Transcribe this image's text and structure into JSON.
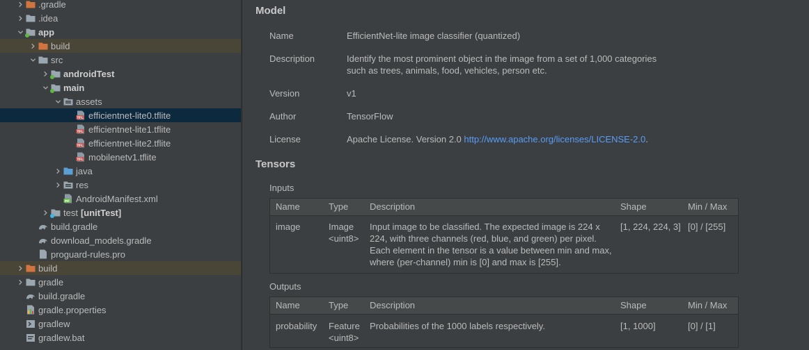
{
  "tree": [
    {
      "label": ".gradle",
      "depth": 1,
      "arrow": "right",
      "icon": "folder-orange-icon"
    },
    {
      "label": ".idea",
      "depth": 1,
      "arrow": "right",
      "icon": "folder-icon"
    },
    {
      "label": "app",
      "depth": 1,
      "arrow": "down",
      "icon": "module-folder-icon",
      "bold": true
    },
    {
      "label": "build",
      "depth": 2,
      "arrow": "right",
      "icon": "folder-orange-icon",
      "bg": "excluded"
    },
    {
      "label": "src",
      "depth": 2,
      "arrow": "down",
      "icon": "folder-icon"
    },
    {
      "label": "androidTest",
      "depth": 3,
      "arrow": "right",
      "icon": "test-folder-icon",
      "bold": true
    },
    {
      "label": "main",
      "depth": 3,
      "arrow": "down",
      "icon": "source-folder-icon",
      "bold": true
    },
    {
      "label": "assets",
      "depth": 4,
      "arrow": "down",
      "icon": "resource-folder-icon"
    },
    {
      "label": "efficientnet-lite0.tflite",
      "depth": 5,
      "arrow": "none",
      "icon": "tflite-file-icon",
      "bg": "selected"
    },
    {
      "label": "efficientnet-lite1.tflite",
      "depth": 5,
      "arrow": "none",
      "icon": "tflite-file-icon"
    },
    {
      "label": "efficientnet-lite2.tflite",
      "depth": 5,
      "arrow": "none",
      "icon": "tflite-file-icon"
    },
    {
      "label": "mobilenetv1.tflite",
      "depth": 5,
      "arrow": "none",
      "icon": "tflite-file-icon"
    },
    {
      "label": "java",
      "depth": 4,
      "arrow": "right",
      "icon": "java-folder-icon"
    },
    {
      "label": "res",
      "depth": 4,
      "arrow": "right",
      "icon": "resource-folder-icon"
    },
    {
      "label": "AndroidManifest.xml",
      "depth": 4,
      "arrow": "none",
      "icon": "manifest-file-icon"
    },
    {
      "label": "test",
      "labelBold": "[unitTest]",
      "depth": 3,
      "arrow": "right",
      "icon": "unit-test-folder-icon"
    },
    {
      "label": "build.gradle",
      "depth": 2,
      "arrow": "none",
      "icon": "gradle-file-icon"
    },
    {
      "label": "download_models.gradle",
      "depth": 2,
      "arrow": "none",
      "icon": "gradle-file-icon"
    },
    {
      "label": "proguard-rules.pro",
      "depth": 2,
      "arrow": "none",
      "icon": "text-file-icon"
    },
    {
      "label": "build",
      "depth": 1,
      "arrow": "right",
      "icon": "folder-orange-icon",
      "bg": "excluded"
    },
    {
      "label": "gradle",
      "depth": 1,
      "arrow": "right",
      "icon": "folder-icon"
    },
    {
      "label": "build.gradle",
      "depth": 1,
      "arrow": "none",
      "icon": "gradle-file-icon"
    },
    {
      "label": "gradle.properties",
      "depth": 1,
      "arrow": "none",
      "icon": "properties-file-icon"
    },
    {
      "label": "gradlew",
      "depth": 1,
      "arrow": "none",
      "icon": "shell-file-icon"
    },
    {
      "label": "gradlew.bat",
      "depth": 1,
      "arrow": "none",
      "icon": "bat-file-icon"
    }
  ],
  "model": {
    "title": "Model",
    "name_label": "Name",
    "name_value": "EfficientNet-lite image classifier (quantized)",
    "description_label": "Description",
    "description_value": "Identify the most prominent object in the image from a set of 1,000 categories such as trees, animals, food, vehicles, person etc.",
    "version_label": "Version",
    "version_value": "v1",
    "author_label": "Author",
    "author_value": "TensorFlow",
    "license_label": "License",
    "license_text": "Apache License. Version 2.0",
    "license_link": "http://www.apache.org/licenses/LICENSE-2.0",
    "license_end": "."
  },
  "tensors": {
    "title": "Tensors",
    "inputs_label": "Inputs",
    "outputs_label": "Outputs",
    "columns": {
      "name": "Name",
      "type": "Type",
      "description": "Description",
      "shape": "Shape",
      "range": "Min / Max"
    },
    "inputs": [
      {
        "name": "image",
        "type": "Image",
        "type2": "<uint8>",
        "description": "Input image to be classified. The expected image is 224 x 224, with three channels (red, blue, and green) per pixel. Each element in the tensor is a value between min and max, where (per-channel) min is [0] and max is [255].",
        "shape": "[1, 224, 224, 3]",
        "range": "[0] / [255]"
      }
    ],
    "outputs": [
      {
        "name": "probability",
        "type": "Feature",
        "type2": "<uint8>",
        "description": "Probabilities of the 1000 labels respectively.",
        "shape": "[1, 1000]",
        "range": "[0] / [1]"
      }
    ]
  },
  "colors": {
    "folder": "#9aa7b0",
    "folder_orange": "#d27440",
    "module_dot": "#62b543",
    "test_dot": "#62b543",
    "unit_test_dot": "#40b6e0",
    "link": "#589df6",
    "selected": "#0d293e",
    "excluded": "#4a4637"
  }
}
